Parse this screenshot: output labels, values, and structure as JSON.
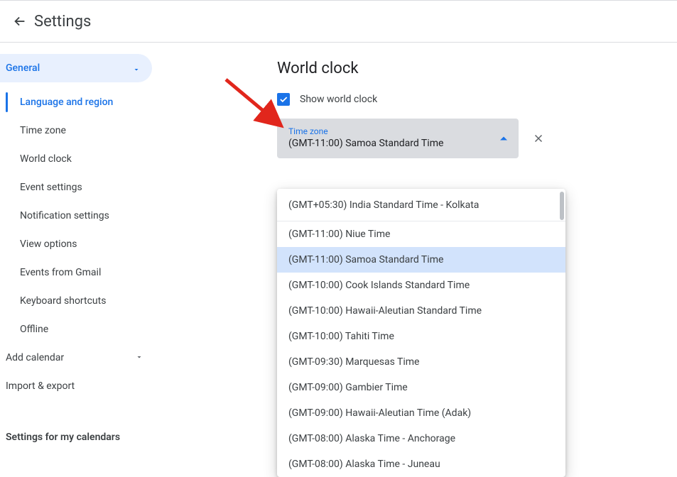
{
  "header": {
    "title": "Settings"
  },
  "sidebar": {
    "root": "General",
    "items": [
      "Language and region",
      "Time zone",
      "World clock",
      "Event settings",
      "Notification settings",
      "View options",
      "Events from Gmail",
      "Keyboard shortcuts",
      "Offline"
    ],
    "sections": {
      "addCalendar": "Add calendar",
      "importExport": "Import & export"
    },
    "heading": "Settings for my calendars"
  },
  "worldClock": {
    "title": "World clock",
    "checkbox": "Show world clock",
    "select": {
      "label": "Time zone",
      "value": "(GMT-11:00) Samoa Standard Time"
    },
    "options": [
      "(GMT+05:30) India Standard Time - Kolkata",
      "(GMT-11:00) Niue Time",
      "(GMT-11:00) Samoa Standard Time",
      "(GMT-10:00) Cook Islands Standard Time",
      "(GMT-10:00) Hawaii-Aleutian Standard Time",
      "(GMT-10:00) Tahiti Time",
      "(GMT-09:30) Marquesas Time",
      "(GMT-09:00) Gambier Time",
      "(GMT-09:00) Hawaii-Aleutian Time (Adak)",
      "(GMT-08:00) Alaska Time - Anchorage",
      "(GMT-08:00) Alaska Time - Juneau"
    ]
  }
}
